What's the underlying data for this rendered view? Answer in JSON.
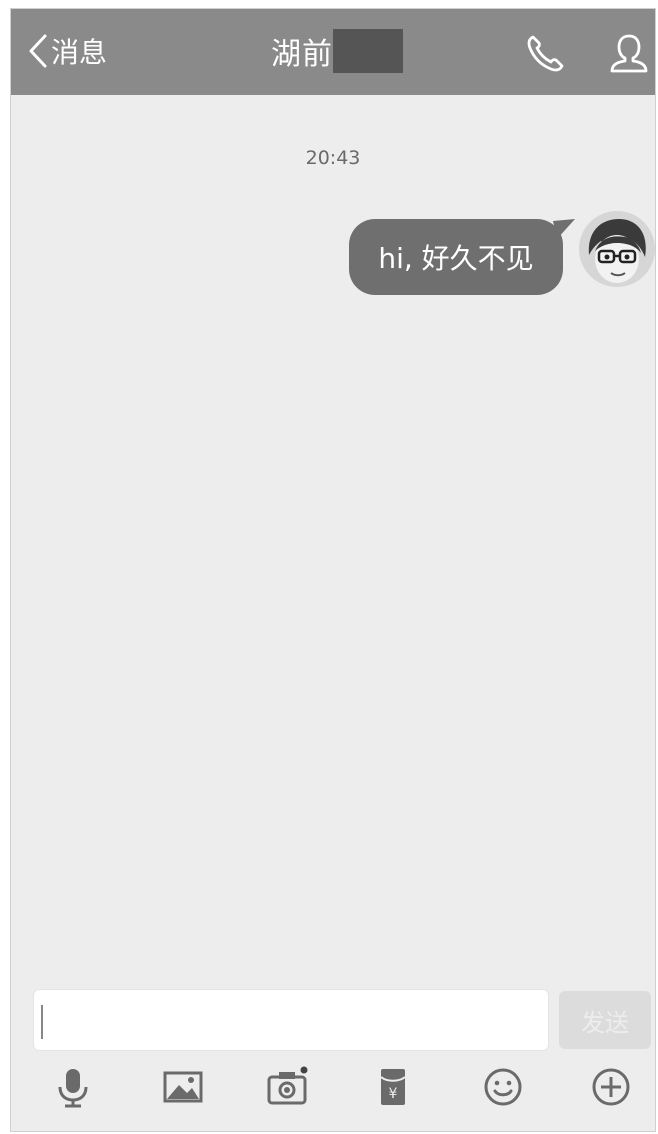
{
  "header": {
    "back_label": "消息",
    "title": "湖前",
    "background": "#8a8a8a"
  },
  "chat": {
    "timestamp": "20:43",
    "messages": [
      {
        "text": "hi, 好久不见",
        "sender": "self"
      }
    ]
  },
  "composer": {
    "placeholder": "",
    "send_label": "发送"
  },
  "toolbar": {
    "icons": [
      "microphone-icon",
      "image-icon",
      "camera-icon",
      "red-packet-icon",
      "emoji-icon",
      "plus-icon"
    ]
  }
}
